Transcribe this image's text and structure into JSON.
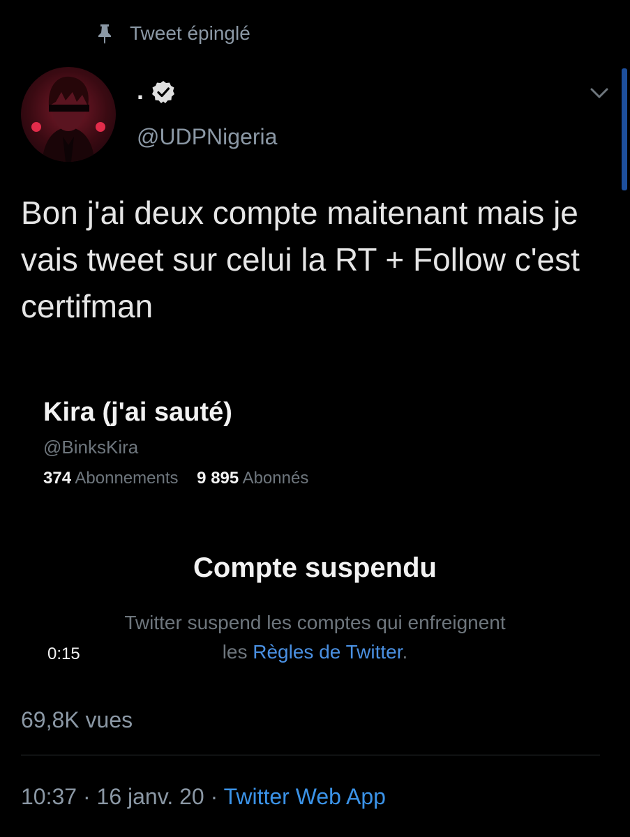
{
  "pinned": {
    "icon": "pin-icon",
    "label": "Tweet épinglé"
  },
  "author": {
    "display_name": ".",
    "verified": true,
    "handle": "@UDPNigeria"
  },
  "tweet": {
    "text": "Bon j'ai deux compte maitenant mais je vais tweet sur celui la RT + Follow c'est certifman"
  },
  "media": {
    "video_time": "0:15",
    "profile_name": "Kira (j'ai sauté)",
    "profile_handle": "@BinksKira",
    "following_count": "374",
    "following_label": "Abonnements",
    "followers_count": "9 895",
    "followers_label": "Abonnés",
    "suspended_title": "Compte suspendu",
    "suspended_text_line1": "Twitter suspend les comptes qui enfreignent",
    "suspended_text_prefix": "les ",
    "suspended_link": "Règles de Twitter",
    "suspended_text_suffix": "."
  },
  "stats": {
    "views": "69,8K vues"
  },
  "meta": {
    "time": "10:37",
    "separator": " · ",
    "date": "16 janv. 20",
    "source": "Twitter Web App"
  },
  "colors": {
    "background": "#000000",
    "secondary_text": "#8b98a5",
    "link": "#3b93e8",
    "scrollbar": "#1d4f9c"
  }
}
